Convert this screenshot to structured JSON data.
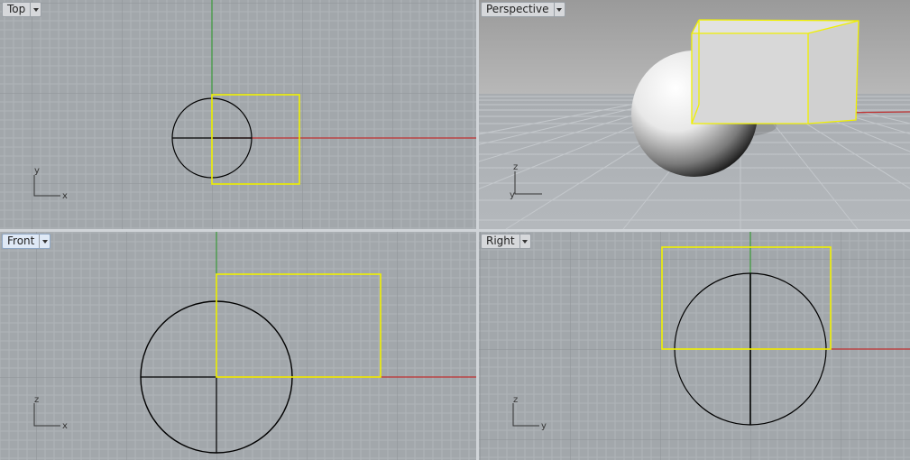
{
  "viewports": {
    "top": {
      "title": "Top",
      "axes": {
        "u": "x",
        "v": "y"
      }
    },
    "perspective": {
      "title": "Perspective",
      "axes": {
        "u": "y",
        "v": "z"
      }
    },
    "front": {
      "title": "Front",
      "axes": {
        "u": "x",
        "v": "z"
      }
    },
    "right": {
      "title": "Right",
      "axes": {
        "u": "y",
        "v": "z"
      }
    }
  },
  "colors": {
    "grid_bg": "#a2a7ab",
    "grid_minor": "#b0b4b8",
    "grid_major": "#8e9397",
    "x_axis": "#c03030",
    "y_axis": "#3a9a3a",
    "selection": "#f0f000",
    "curve": "#000000",
    "active_tab": "#dfe9f6"
  },
  "icons": {
    "dropdown": "triangle-down-icon"
  }
}
